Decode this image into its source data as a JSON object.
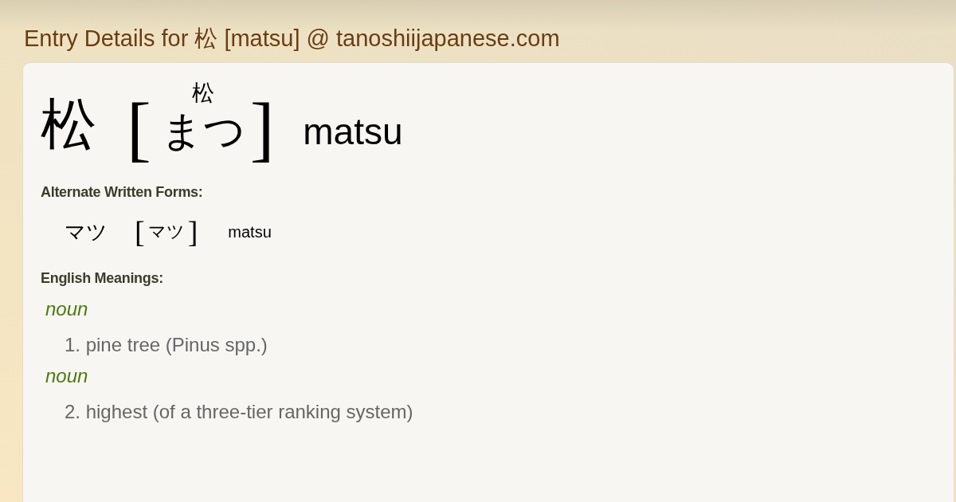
{
  "page_title": "Entry Details for 松 [matsu] @ tanoshiijapanese.com",
  "entry": {
    "kanji": "松",
    "open_bracket": "[",
    "reading_ruby": "松",
    "reading": "まつ",
    "close_bracket": "]",
    "romaji": "matsu"
  },
  "alternate_forms": {
    "heading": "Alternate Written Forms:",
    "forms": [
      {
        "written": "マツ",
        "open_bracket": "[",
        "reading": "マツ",
        "close_bracket": "]",
        "romaji": "matsu"
      }
    ]
  },
  "meanings": {
    "heading": "English Meanings:",
    "senses": [
      {
        "part_of_speech": "noun",
        "definition": "1. pine tree (Pinus spp.)"
      },
      {
        "part_of_speech": "noun",
        "definition": "2. highest (of a three-tier ranking system)"
      }
    ]
  }
}
